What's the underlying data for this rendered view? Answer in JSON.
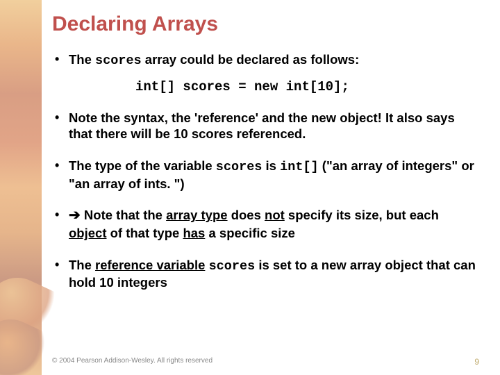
{
  "title": "Declaring Arrays",
  "code_line": "int[] scores = new int[10];",
  "bullets": {
    "b1_a": "The ",
    "b1_code": "scores",
    "b1_b": " array could be declared as follows:",
    "b2": "Note the syntax, the 'reference' and the new object! It also says that there will be 10 scores referenced.",
    "b3_a": "The type of the variable ",
    "b3_code1": "scores",
    "b3_b": " is ",
    "b3_code2": "int[]",
    "b3_c": " (\"an array of integers\" or \"an array of ints. \")",
    "b4_arrow": "➔",
    "b4_a": "  Note that the ",
    "b4_u1": "array type",
    "b4_b": " does ",
    "b4_u2": "not",
    "b4_c": " specify its size, but each ",
    "b4_u3": "object",
    "b4_d": " of that type ",
    "b4_u4": "has",
    "b4_e": " a specific size",
    "b5_a": "The ",
    "b5_u1": "reference variable",
    "b5_b": " ",
    "b5_code": "scores",
    "b5_c": " is set to a new array object that can hold 10 integers"
  },
  "footer": {
    "copyright": "© 2004 Pearson Addison-Wesley. All rights reserved",
    "page": "9"
  }
}
